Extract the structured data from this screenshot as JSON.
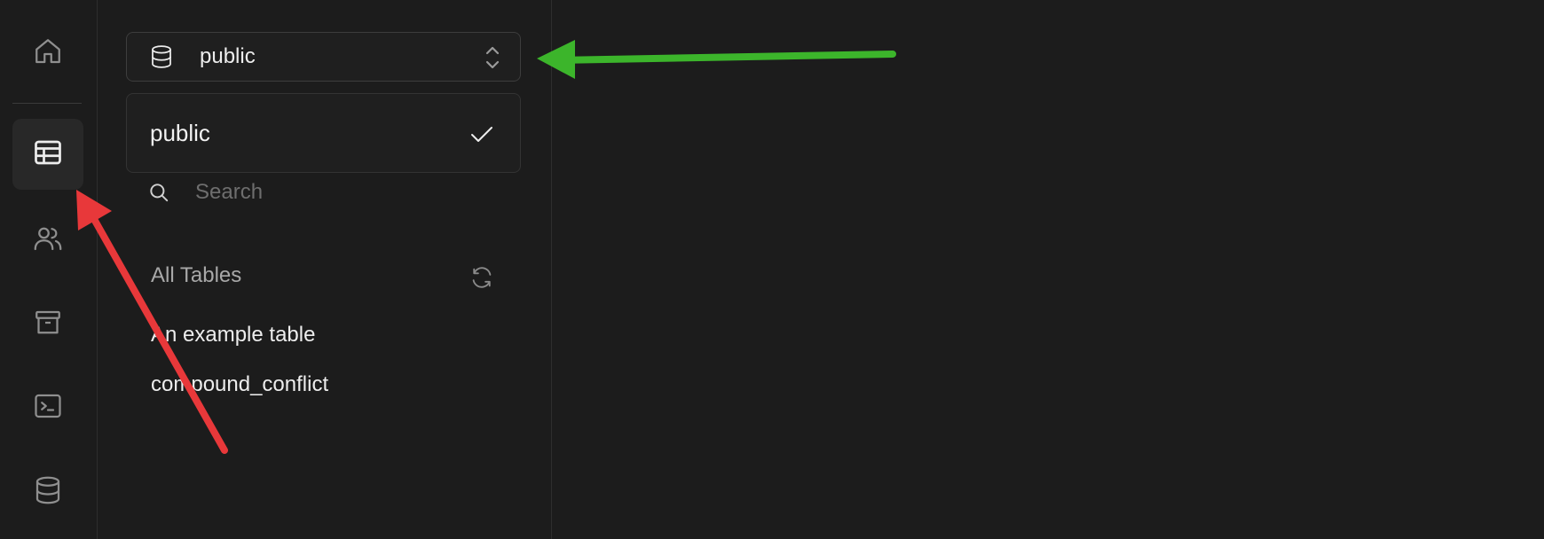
{
  "rail": {
    "items": [
      {
        "icon": "home-icon",
        "active": false
      },
      {
        "icon": "table-editor-icon",
        "active": true
      },
      {
        "icon": "users-icon",
        "active": false
      },
      {
        "icon": "archive-icon",
        "active": false
      },
      {
        "icon": "terminal-icon",
        "active": false
      },
      {
        "icon": "database-icon",
        "active": false
      }
    ]
  },
  "schema_select": {
    "icon": "database-icon",
    "value": "public",
    "chevron_icon": "chevron-up-down-icon"
  },
  "dropdown": {
    "options": [
      {
        "label": "public",
        "selected": true
      }
    ]
  },
  "search": {
    "placeholder": "Search"
  },
  "tables": {
    "section_title": "All Tables",
    "items": [
      "An example table",
      "compound_conflict"
    ]
  },
  "annotations": {
    "arrow_colors": {
      "green": "#3cb52b",
      "red": "#e8383a"
    }
  },
  "colors": {
    "background": "#1c1c1c",
    "border": "#2e2e2e",
    "active_item": "#282828",
    "muted_text": "#6e6e6e"
  }
}
